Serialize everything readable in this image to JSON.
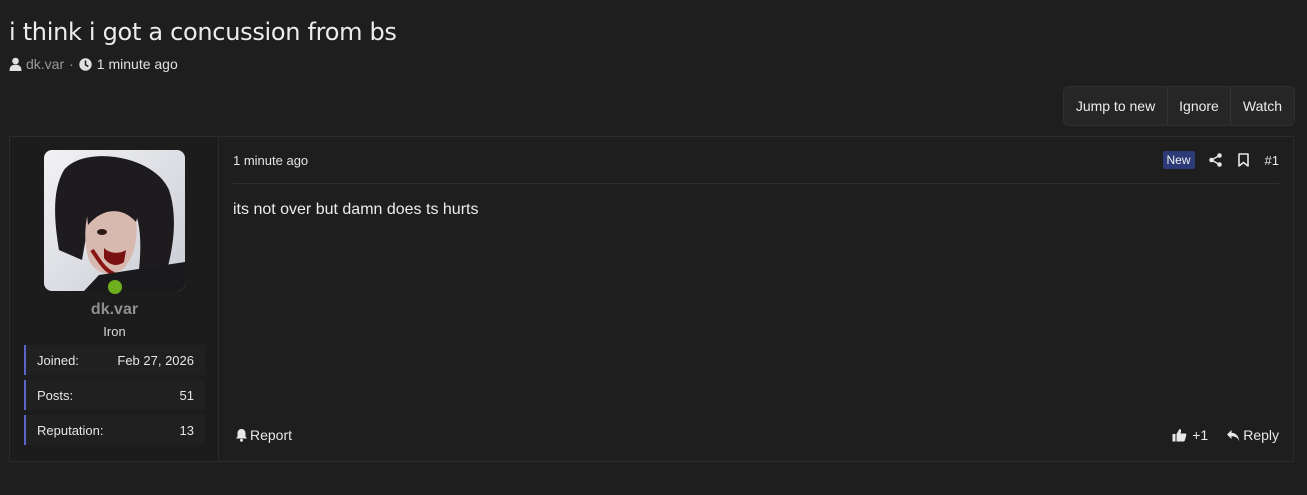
{
  "thread": {
    "title": "i think i got a concussion from bs",
    "author": "dk.var",
    "separator": "·",
    "time": "1 minute ago"
  },
  "actions": {
    "jump_to_new": "Jump to new",
    "ignore": "Ignore",
    "watch": "Watch"
  },
  "user": {
    "name": "dk.var",
    "title": "Iron",
    "online": true,
    "stats": [
      {
        "label": "Joined:",
        "value": "Feb 27, 2026"
      },
      {
        "label": "Posts:",
        "value": "51"
      },
      {
        "label": "Reputation:",
        "value": "13"
      }
    ]
  },
  "post": {
    "time": "1 minute ago",
    "badge": "New",
    "number": "#1",
    "body": "its not over but damn does ts hurts",
    "report": "Report",
    "reaction": "+1",
    "reply": "Reply"
  },
  "colors": {
    "background": "#1e1e1e",
    "accent": "#5b63c9",
    "badge_new": "#2c3a77",
    "online": "#6fae1c"
  },
  "icons": [
    "user-icon",
    "clock-icon",
    "share-icon",
    "bookmark-icon",
    "bell-icon",
    "thumbs-up-icon",
    "reply-icon"
  ]
}
